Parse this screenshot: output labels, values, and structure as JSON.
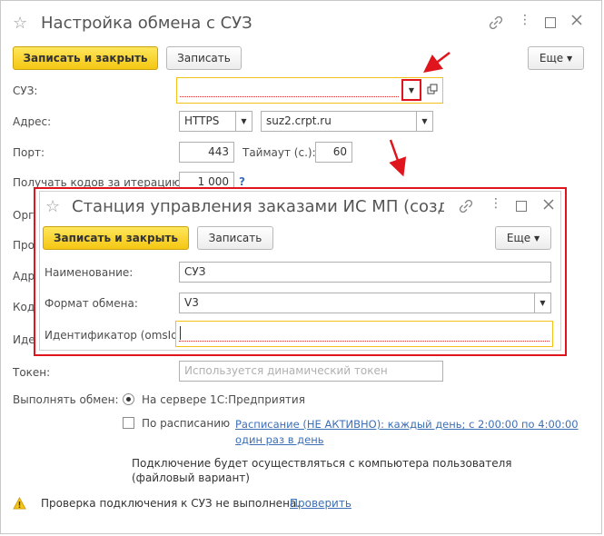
{
  "main": {
    "title": "Настройка обмена с СУЗ",
    "more_icon": "⋮",
    "buttons": {
      "save_close": "Записать и закрыть",
      "save": "Записать",
      "more": "Еще"
    },
    "fields": {
      "suz_label": "СУЗ:",
      "address_label": "Адрес:",
      "protocol": "HTTPS",
      "host": "suz2.crpt.ru",
      "port_label": "Порт:",
      "port": "443",
      "timeout_label": "Таймаут (с.):",
      "timeout": "60",
      "codes_label": "Получать кодов за итерацию:",
      "codes": "1 000",
      "help": "?",
      "hidden_labels": [
        "Орг",
        "Про",
        "Адр",
        "Код",
        "Иде"
      ],
      "token_label": "Токен:",
      "token_placeholder": "Используется динамический токен"
    },
    "exchange": {
      "label": "Выполнять обмен:",
      "option_server": "На сервере 1С:Предприятия",
      "option_schedule": "По расписанию",
      "schedule_link_1": "Расписание (НЕ АКТИВНО): каждый день; с 2:00:00 по 4:00:00",
      "schedule_link_2": "один раз в день",
      "note_1": "Подключение будет осуществляться с компьютера пользователя",
      "note_2": "(файловый вариант)"
    },
    "status": {
      "message": "Проверка подключения к СУЗ не выполнена.",
      "check_link": "Проверить"
    }
  },
  "dialog": {
    "title": "Станция управления заказами ИС МП (созда...",
    "more_icon": "⋮",
    "buttons": {
      "save_close": "Записать и закрыть",
      "save": "Записать",
      "more": "Еще"
    },
    "fields": {
      "name_label": "Наименование:",
      "name": "СУЗ",
      "format_label": "Формат обмена:",
      "format": "V3",
      "id_label": "Идентификатор (omsId):",
      "id": ""
    }
  },
  "colors": {
    "highlight": "#e0141c",
    "primary_button": "#f4c712",
    "link": "#3d6fb6"
  }
}
